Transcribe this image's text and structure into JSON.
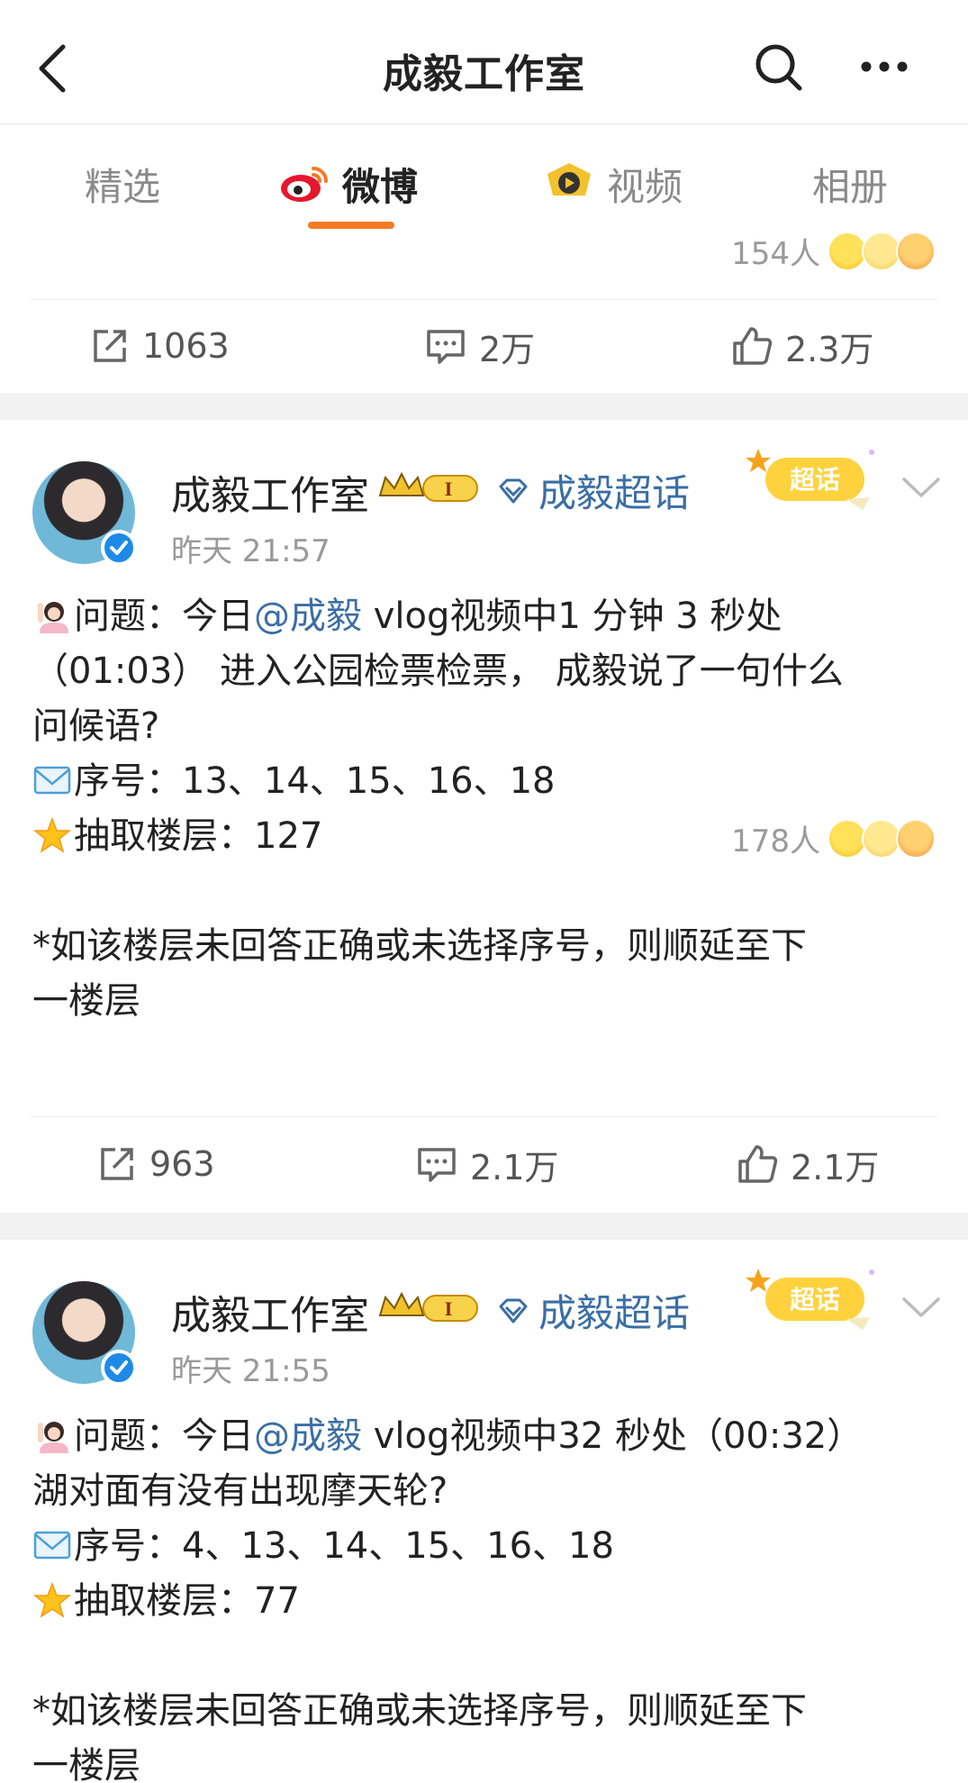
{
  "header": {
    "title": "成毅工作室"
  },
  "tabs": [
    {
      "label": "精选"
    },
    {
      "label": "微博"
    },
    {
      "label": "视频"
    },
    {
      "label": "相册"
    }
  ],
  "prev_post": {
    "reaction_count": "154人",
    "repost": "1063",
    "comment": "2万",
    "like": "2.3万"
  },
  "posts": [
    {
      "author": "成毅工作室",
      "vip_level": "I",
      "supertopic": "成毅超话",
      "badge": "超话",
      "time": "昨天 21:57",
      "q_prefix": "问题：今日",
      "mention": "@成毅",
      "q_rest": " vlog视频中1 分钟 3 秒处",
      "line2": "（01:03） 进入公园检票检票， 成毅说了一句什么",
      "line3": "问候语?",
      "numbers": "序号：13、14、15、16、18",
      "floor": "抽取楼层：127",
      "note1": "*如该楼层未回答正确或未选择序号，则顺延至下",
      "note2": "一楼层",
      "reaction_count": "178人",
      "repost": "963",
      "comment": "2.1万",
      "like": "2.1万"
    },
    {
      "author": "成毅工作室",
      "vip_level": "I",
      "supertopic": "成毅超话",
      "badge": "超话",
      "time": "昨天 21:55",
      "q_prefix": "问题：今日",
      "mention": "@成毅",
      "q_rest": " vlog视频中32 秒处（00:32）",
      "line2": "湖对面有没有出现摩天轮?",
      "numbers": "序号：4、13、14、15、16、18",
      "floor": "抽取楼层：77",
      "note1": "*如该楼层未回答正确或未选择序号，则顺延至下",
      "note2": "一楼层"
    }
  ],
  "colors": {
    "accent": "#f47a26",
    "link": "#3a6ea5",
    "muted": "#9a9a9a",
    "verified": "#1e8ae8"
  }
}
